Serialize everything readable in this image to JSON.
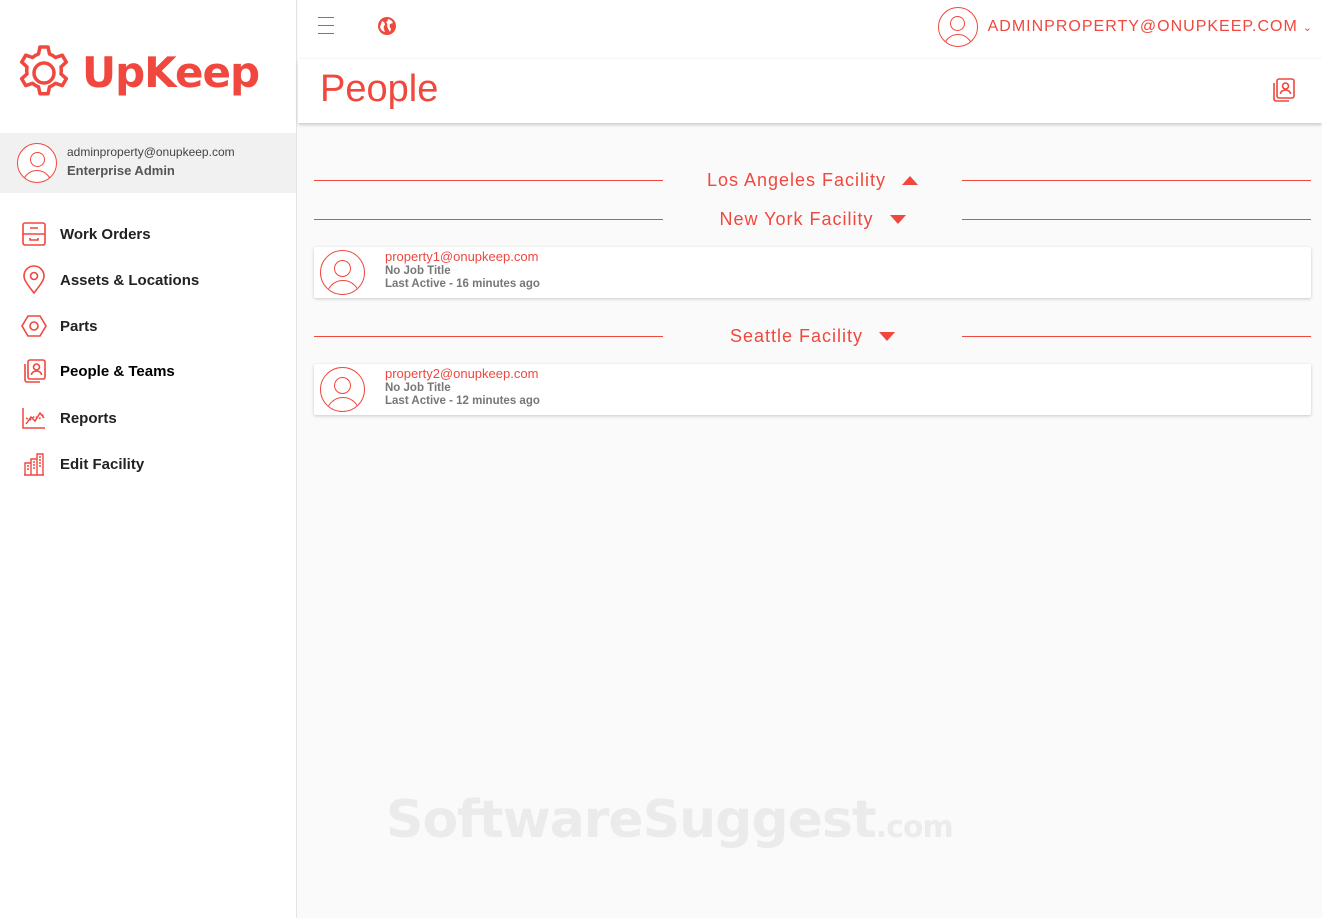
{
  "brand": {
    "name": "UpKeep",
    "accent": "#f0473e"
  },
  "sidebar": {
    "user": {
      "email": "adminproperty@onupkeep.com",
      "role": "Enterprise Admin"
    },
    "items": [
      {
        "label": "Work Orders",
        "icon": "inbox-tray-icon",
        "active": false
      },
      {
        "label": "Assets & Locations",
        "icon": "map-pin-icon",
        "active": false
      },
      {
        "label": "Parts",
        "icon": "hex-nut-icon",
        "active": false
      },
      {
        "label": "People & Teams",
        "icon": "people-cards-icon",
        "active": true
      },
      {
        "label": "Reports",
        "icon": "line-chart-icon",
        "active": false
      },
      {
        "label": "Edit Facility",
        "icon": "buildings-icon",
        "active": false
      }
    ]
  },
  "topbar": {
    "user_label": "ADMINPROPERTY@ONUPKEEP.COM",
    "caret": "⌄"
  },
  "page": {
    "title": "People"
  },
  "facilities": [
    {
      "name": "Los Angeles Facility",
      "expanded": true,
      "people": []
    },
    {
      "name": "New York Facility",
      "expanded": false,
      "people": [
        {
          "email": "property1@onupkeep.com",
          "job": "No Job Title",
          "active": "Last Active - 16 minutes ago"
        }
      ]
    },
    {
      "name": "Seattle Facility",
      "expanded": false,
      "people": [
        {
          "email": "property2@onupkeep.com",
          "job": "No Job Title",
          "active": "Last Active - 12 minutes ago"
        }
      ]
    }
  ],
  "watermark": {
    "main": "SoftwareSuggest",
    "suffix": ".com"
  }
}
